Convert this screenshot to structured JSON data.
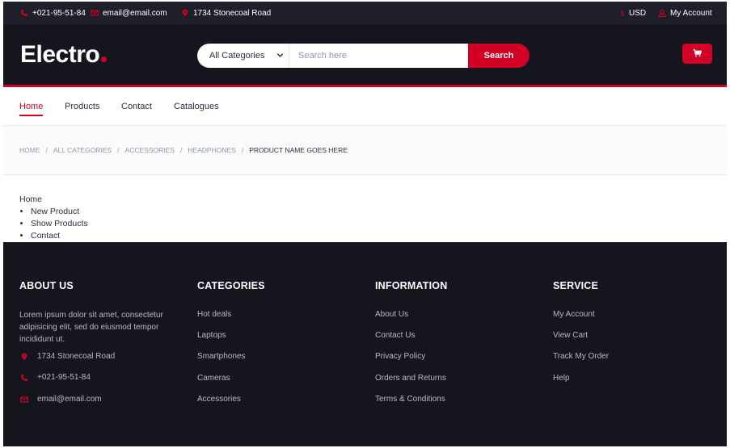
{
  "colors": {
    "accent": "#d10024",
    "dark": "#15161d",
    "topbar": "#1e1f29"
  },
  "topbar": {
    "phone": {
      "icon": "phone-icon",
      "text": "+021-95-51-84"
    },
    "email": {
      "icon": "envelope-icon",
      "text": "email@email.com"
    },
    "address": {
      "icon": "map-marker-icon",
      "text": "1734 Stonecoal Road"
    },
    "currency": {
      "icon": "dollar-icon",
      "text": "USD"
    },
    "account": {
      "icon": "user-icon",
      "text": "My Account"
    }
  },
  "header": {
    "logo": "Electro",
    "category_select": "All Categories",
    "search_placeholder": "Search here",
    "search_button": "Search",
    "cart_icon": "cart-icon"
  },
  "nav": {
    "items": [
      {
        "label": "Home",
        "active": true
      },
      {
        "label": "Products"
      },
      {
        "label": "Contact"
      },
      {
        "label": "Catalogues"
      }
    ]
  },
  "breadcrumb": {
    "items": [
      "Home",
      "All Categories",
      "Accessories",
      "Headphones"
    ],
    "current": "Product name goes here"
  },
  "plain_menu": {
    "title": "Home",
    "items": [
      "New Product",
      "Show Products",
      "Contact"
    ]
  },
  "footer": {
    "about": {
      "title": "ABOUT US",
      "text": "Lorem ipsum dolor sit amet, consectetur adipisicing elit, sed do eiusmod tempor incididunt ut.",
      "address": "1734 Stonecoal Road",
      "phone": "+021-95-51-84",
      "email": "email@email.com"
    },
    "categories": {
      "title": "CATEGORIES",
      "links": [
        "Hot deals",
        "Laptops",
        "Smartphones",
        "Cameras",
        "Accessories"
      ]
    },
    "information": {
      "title": "INFORMATION",
      "links": [
        "About Us",
        "Contact Us",
        "Privacy Policy",
        "Orders and Returns",
        "Terms & Conditions"
      ]
    },
    "service": {
      "title": "SERVICE",
      "links": [
        "My Account",
        "View Cart",
        "Track My Order",
        "Help"
      ]
    }
  }
}
